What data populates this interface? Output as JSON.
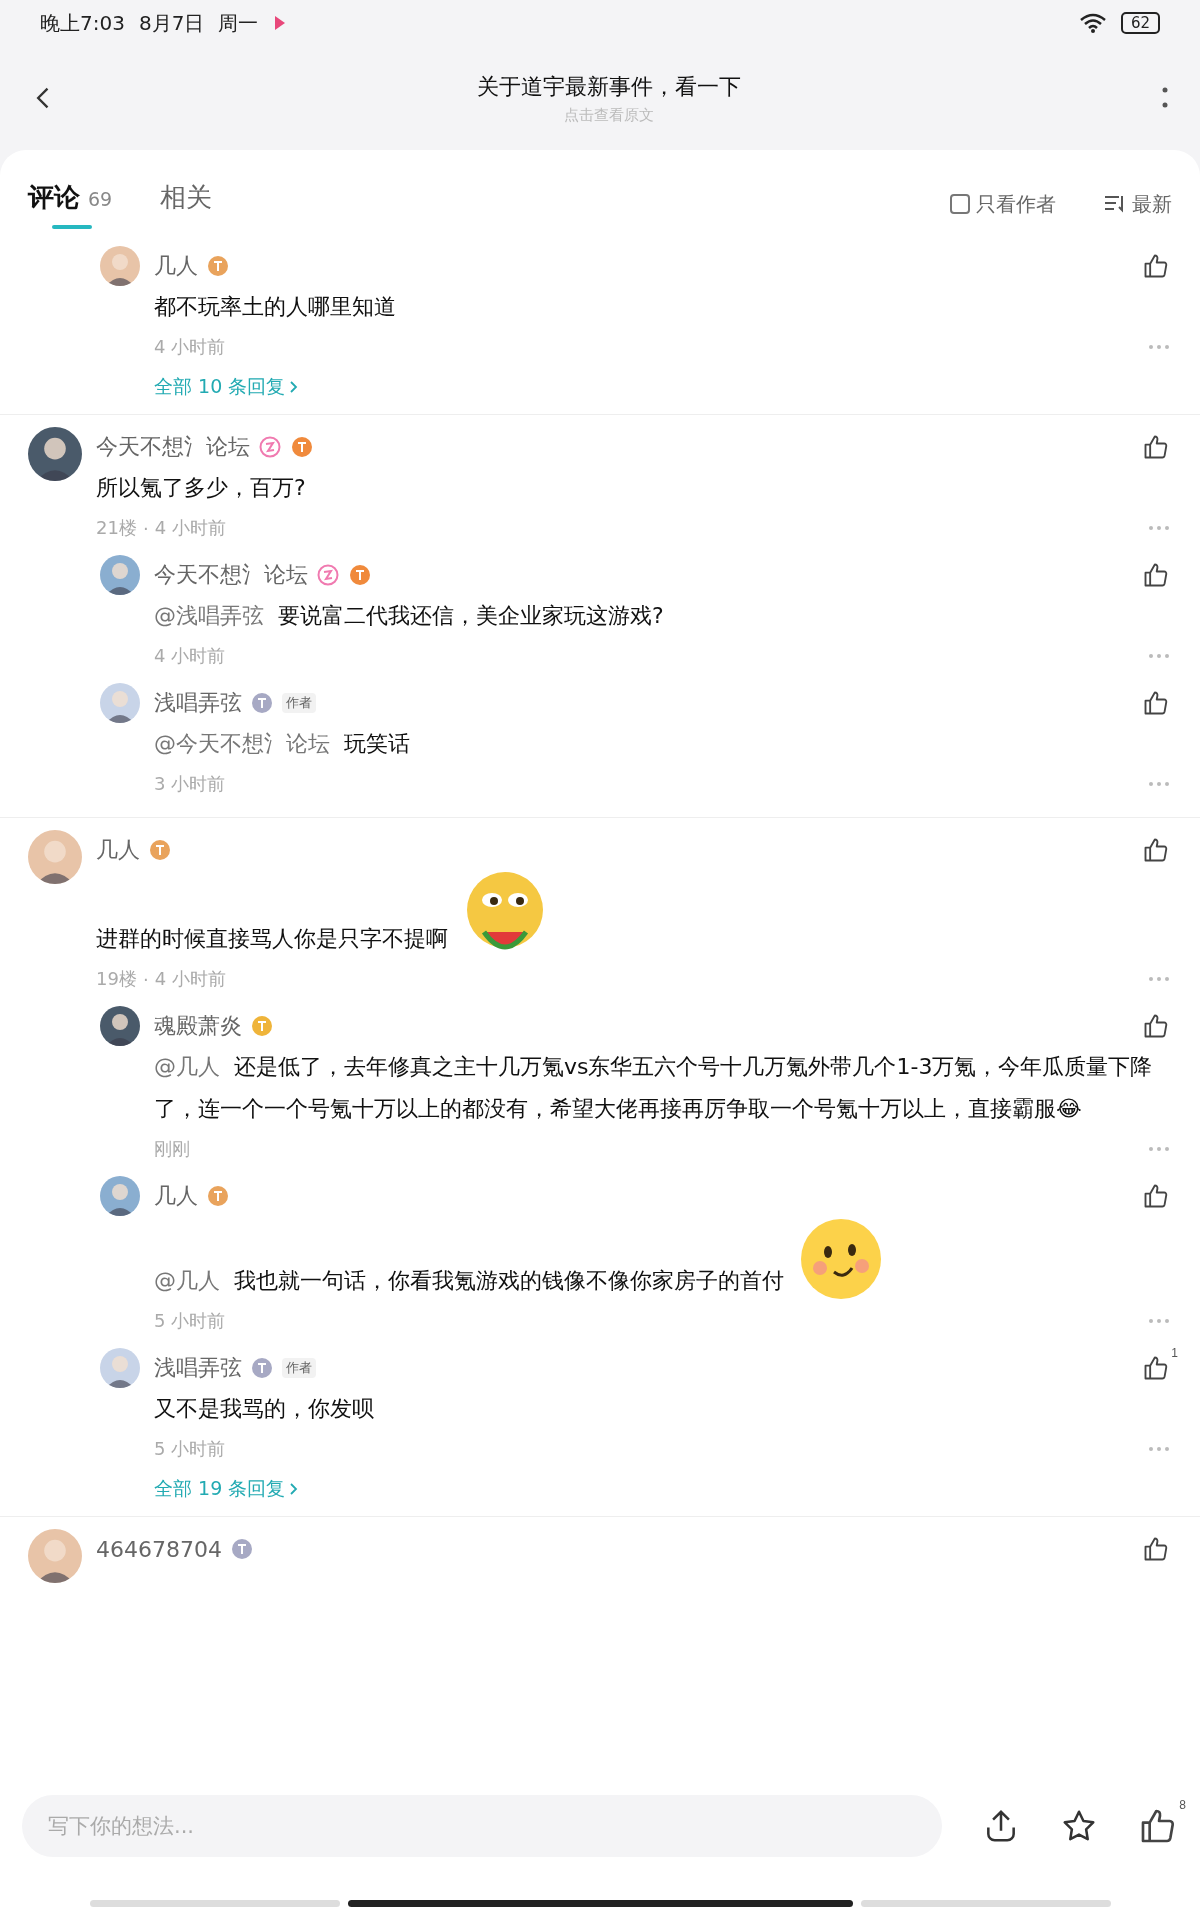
{
  "status_bar": {
    "time": "晚上7:03",
    "date": "8月7日",
    "weekday": "周一",
    "battery": "62"
  },
  "header": {
    "title": "关于道宇最新事件，看一下",
    "subtitle": "点击查看原文"
  },
  "tabs": [
    {
      "label": "评论",
      "count": "69",
      "selected": true
    },
    {
      "label": "相关",
      "selected": false
    }
  ],
  "filters": {
    "author_only": {
      "label": "只看作者",
      "checked": false
    },
    "sort": {
      "label": "最新"
    }
  },
  "threads": [
    {
      "replies": [
        {
          "name": "几人",
          "badges": [
            {
              "kind": "level",
              "color": "#e9a35c"
            }
          ],
          "text": "都不玩率土的人哪里知道",
          "time": "4 小时前"
        }
      ],
      "more_replies": "全部 10 条回复"
    },
    {
      "comment": {
        "name": "今天不想氵论坛",
        "badges": [
          {
            "kind": "fan",
            "color": "#f07ab0"
          },
          {
            "kind": "level",
            "color": "#f08a3c"
          }
        ],
        "text": "所以氪了多少，百万?",
        "floor": "21楼",
        "separator": "·",
        "time": "4 小时前"
      },
      "replies": [
        {
          "name": "今天不想氵论坛",
          "badges": [
            {
              "kind": "fan",
              "color": "#f07ab0"
            },
            {
              "kind": "level",
              "color": "#f08a3c"
            }
          ],
          "mention": "@浅唱弄弦",
          "text": "要说富二代我还信，美企业家玩这游戏?",
          "time": "4 小时前"
        },
        {
          "name": "浅唱弄弦",
          "badges": [
            {
              "kind": "level",
              "color": "#a7a9c4"
            }
          ],
          "author_tag": "作者",
          "mention": "@今天不想氵论坛",
          "text": "玩笑话",
          "time": "3 小时前"
        }
      ]
    },
    {
      "comment": {
        "name": "几人",
        "badges": [
          {
            "kind": "level",
            "color": "#e9a35c"
          }
        ],
        "text": "进群的时候直接骂人你是只字不提啊",
        "sticker": {
          "kind": "watermelon"
        },
        "floor": "19楼",
        "separator": "·",
        "time": "4 小时前"
      },
      "replies": [
        {
          "name": "魂殿萧炎",
          "badges": [
            {
              "kind": "level",
              "color": "#efb43a"
            }
          ],
          "mention": "@几人",
          "text": "还是低了，去年修真之主十几万氪vs东华五六个号十几万氪外带几个1-3万氪，今年瓜质量下降了，连一个一个号氪十万以上的都没有，希望大佬再接再厉争取一个号氪十万以上，直接霸服😂",
          "time": "刚刚"
        },
        {
          "name": "几人",
          "badges": [
            {
              "kind": "level",
              "color": "#e9a35c"
            }
          ],
          "mention": "@几人",
          "text": "我也就一句话，你看我氪游戏的钱像不像你家房子的首付",
          "sticker": {
            "kind": "smile"
          },
          "time": "5 小时前"
        },
        {
          "name": "浅唱弄弦",
          "badges": [
            {
              "kind": "level",
              "color": "#a7a9c4"
            }
          ],
          "author_tag": "作者",
          "text": "又不是我骂的，你发呗",
          "time": "5 小时前",
          "likes": "1"
        }
      ],
      "more_replies": "全部 19 条回复"
    },
    {
      "comment": {
        "name": "464678704",
        "badges": [
          {
            "kind": "level",
            "color": "#a7a9c4"
          }
        ]
      }
    }
  ],
  "composer": {
    "placeholder": "写下你的想法...",
    "likes": "8"
  }
}
